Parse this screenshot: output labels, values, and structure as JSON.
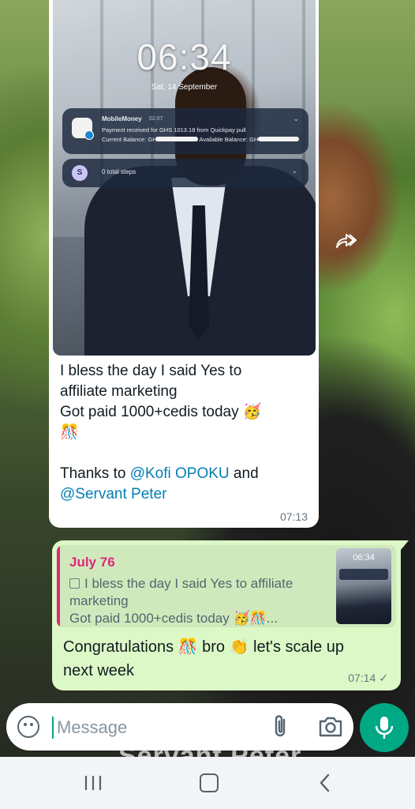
{
  "chat": {
    "incoming": {
      "screenshot": {
        "lock_time": "06:34",
        "lock_date": "Sat, 14 September",
        "notification": {
          "app": "MobileMoney",
          "time": "02:07",
          "line1": "Payment received for GHS 1013.18 from Quickpay pull",
          "line2": "Current Balance: GH",
          "line2b": ". Available Balance: GH"
        },
        "steps": {
          "icon_letter": "S",
          "label": "0 total steps"
        }
      },
      "text_lines": [
        "I bless the day I said Yes to",
        "affiliate marketing",
        "Got paid 1000+cedis  today 🥳",
        "🎊"
      ],
      "thanks_prefix": "Thanks to ",
      "mention1": "@Kofi OPOKU",
      "and_text": " and",
      "mention2": "@Servant Peter",
      "time": "07:13"
    },
    "outgoing": {
      "quote": {
        "author": "July 76",
        "lines": [
          "I bless the day I said Yes to affiliate",
          "marketing",
          "Got paid 1000+cedis  today 🥳🎊..."
        ],
        "thumb_time": "06:34"
      },
      "text_lines": [
        "Congratulations 🎊 bro 👏 let's scale up",
        "next week"
      ],
      "time": "07:14",
      "status": "✓"
    }
  },
  "wallpaper_text": "Servant Peter",
  "input": {
    "placeholder": "Message"
  },
  "icons": {
    "forward": "forward-icon",
    "emoji": "emoji-icon",
    "attach": "paperclip-icon",
    "camera": "camera-icon",
    "mic": "microphone-icon",
    "nav_recent": "recent-apps-icon",
    "nav_home": "home-icon",
    "nav_back": "back-icon"
  },
  "colors": {
    "accent": "#00a884",
    "outgoing_bubble": "#dcf8c6",
    "mention": "#027eb5",
    "quote_author": "#e0267a"
  }
}
